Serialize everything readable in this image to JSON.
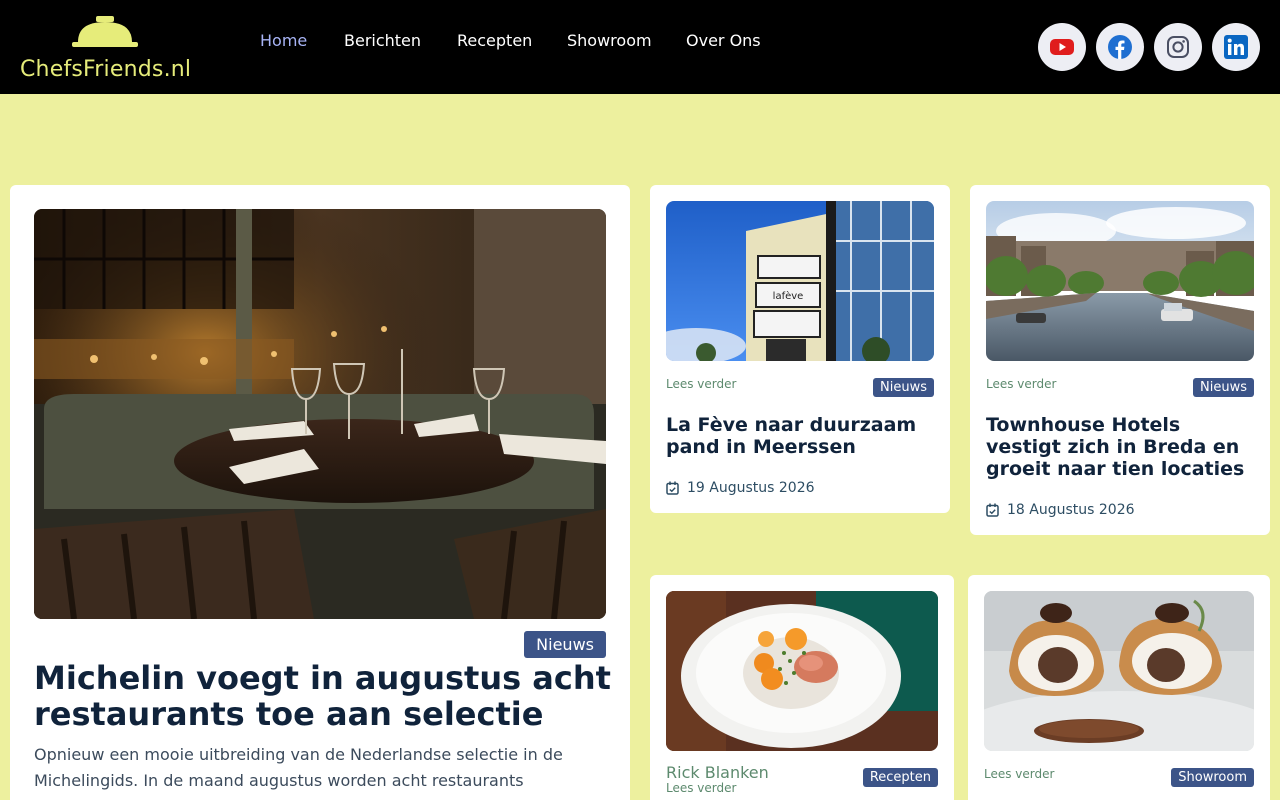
{
  "header": {
    "logo_text": "ChefsFriends.nl",
    "nav": [
      "Home",
      "Berichten",
      "Recepten",
      "Showroom",
      "Over Ons"
    ],
    "active_nav": "Home",
    "social": [
      "youtube-icon",
      "facebook-icon",
      "instagram-icon",
      "linkedin-icon"
    ]
  },
  "featured": {
    "badge": "Nieuws",
    "title": "Michelin voegt in augustus acht restaurants toe aan selectie",
    "excerpt": "Opnieuw een mooie uitbreiding van de Nederlandse selectie in de Michelingids. In de maand augustus worden acht restaurants"
  },
  "cards": [
    {
      "lees": "Lees verder",
      "badge": "Nieuws",
      "title": "La Fève naar duurzaam pand in Meerssen",
      "date": "19 Augustus 2026",
      "sign_text": "lafève"
    },
    {
      "lees": "Lees verder",
      "badge": "Nieuws",
      "title": "Townhouse Hotels vestigt zich in Breda en groeit naar tien locaties",
      "date": "18 Augustus 2026"
    },
    {
      "author": "Rick Blanken",
      "lees": "Lees verder",
      "badge": "Recepten"
    },
    {
      "lees": "Lees verder",
      "badge": "Showroom"
    }
  ],
  "colors": {
    "header_bg": "#000000",
    "page_bg": "#edf09e",
    "logo": "#e6ec7a",
    "nav_active": "#a8b4f5",
    "badge": "#3c5488",
    "title": "#10233b",
    "link": "#5d8a6e"
  }
}
